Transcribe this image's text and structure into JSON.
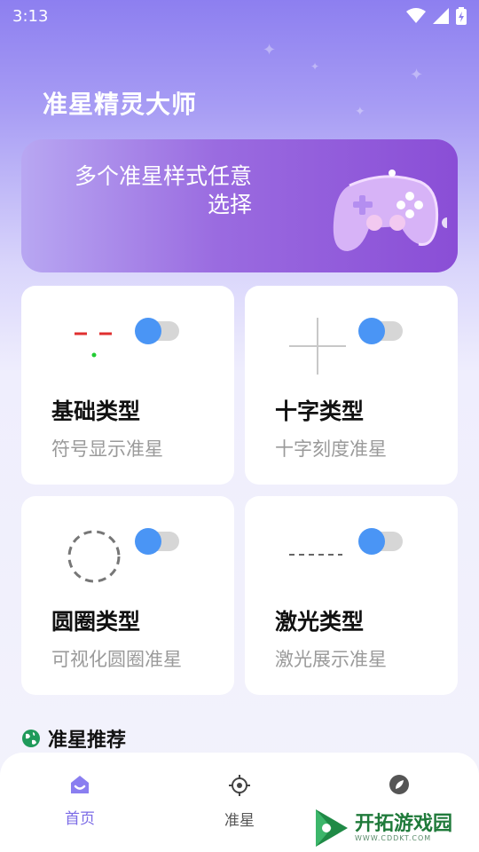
{
  "status_bar": {
    "time": "3:13"
  },
  "app": {
    "title": "准星精灵大师"
  },
  "banner": {
    "text": "多个准星样式任意选择"
  },
  "cards": [
    {
      "title": "基础类型",
      "subtitle": "符号显示准星",
      "icon": "basic-crosshair-icon",
      "enabled": true
    },
    {
      "title": "十字类型",
      "subtitle": "十字刻度准星",
      "icon": "cross-crosshair-icon",
      "enabled": true
    },
    {
      "title": "圆圈类型",
      "subtitle": "可视化圆圈准星",
      "icon": "circle-crosshair-icon",
      "enabled": true
    },
    {
      "title": "激光类型",
      "subtitle": "激光展示准星",
      "icon": "laser-crosshair-icon",
      "enabled": true
    }
  ],
  "section": {
    "title": "准星推荐"
  },
  "nav": {
    "items": [
      {
        "label": "首页",
        "icon": "home-icon",
        "active": true
      },
      {
        "label": "准星",
        "icon": "crosshair-icon",
        "active": false
      },
      {
        "label": "",
        "icon": "leaf-icon",
        "active": false
      }
    ]
  },
  "watermark": {
    "name": "开拓游戏园",
    "url": "WWW.CDDKT.COM"
  },
  "colors": {
    "accent": "#4a95f5",
    "nav_active": "#7b6be6",
    "banner_end": "#8a4ed6"
  }
}
